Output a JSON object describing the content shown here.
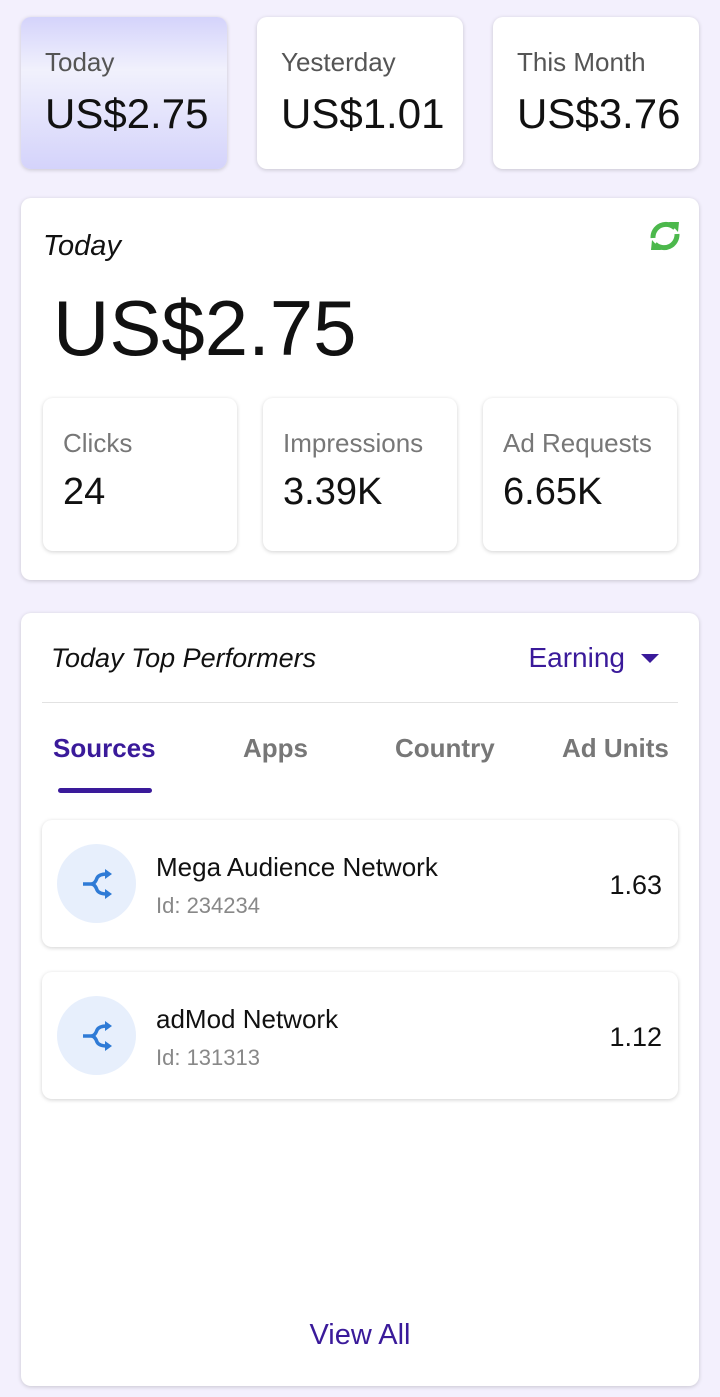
{
  "summary": [
    {
      "label": "Today",
      "value": "US$2.75"
    },
    {
      "label": "Yesterday",
      "value": "US$1.01"
    },
    {
      "label": "This Month",
      "value": "US$3.76"
    }
  ],
  "today": {
    "title": "Today",
    "value": "US$2.75",
    "stats": [
      {
        "label": "Clicks",
        "value": "24"
      },
      {
        "label": "Impressions",
        "value": "3.39K"
      },
      {
        "label": "Ad Requests",
        "value": "6.65K"
      }
    ]
  },
  "performers": {
    "title": "Today Top Performers",
    "metric": "Earning",
    "tabs": [
      "Sources",
      "Apps",
      "Country",
      "Ad Units"
    ],
    "active_tab": "Sources",
    "rows": [
      {
        "name": "Mega Audience Network",
        "id": "Id: 234234",
        "value": "1.63"
      },
      {
        "name": "adMod Network",
        "id": "Id: 131313",
        "value": "1.12"
      }
    ],
    "view_all": "View All"
  },
  "colors": {
    "accent": "#3a1a9a",
    "refresh": "#4cb84c",
    "icon": "#2f7bd6"
  }
}
